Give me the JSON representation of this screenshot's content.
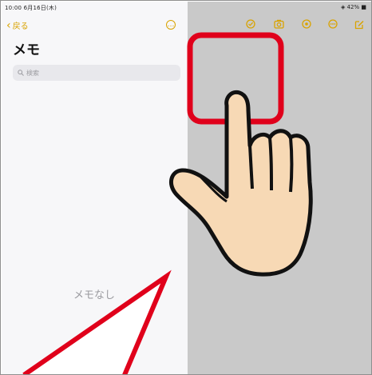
{
  "status": {
    "left": "10:00 6月16日(木)",
    "right": "◈ 42% ■"
  },
  "sidebar": {
    "back_label": "戻る",
    "title": "メモ",
    "search_placeholder": "検索",
    "empty_text": "メモなし"
  },
  "toolbar": {
    "icons": [
      "checklist-icon",
      "camera-icon",
      "markup-icon",
      "more-icon",
      "compose-icon"
    ]
  },
  "colors": {
    "accent": "#d9a300",
    "highlight": "#e0001b",
    "hand_fill": "#f7d9b5"
  }
}
